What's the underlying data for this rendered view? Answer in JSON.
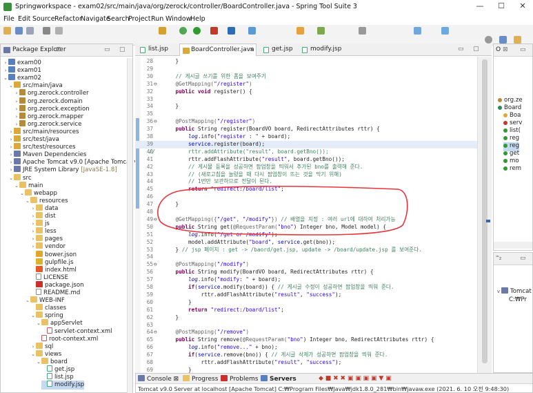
{
  "window": {
    "title": "Springworkspace - exam02/src/main/java/org/zerock/controller/BoardController.java - Spring Tool Suite 3",
    "minimize": "—",
    "maximize": "☐",
    "close": "✕"
  },
  "menu": [
    "File",
    "Edit",
    "Source",
    "Refactor",
    "Navigate",
    "Search",
    "Project",
    "Run",
    "Window",
    "Help"
  ],
  "package_explorer": {
    "tab": "Package Explorer",
    "items": [
      {
        "depth": 0,
        "tw": ">",
        "icon": "proj",
        "label": "exam00",
        "extra": ""
      },
      {
        "depth": 0,
        "tw": ">",
        "icon": "proj",
        "label": "exam01",
        "extra": ""
      },
      {
        "depth": 0,
        "tw": "v",
        "icon": "proj",
        "label": "exam02",
        "extra": ""
      },
      {
        "depth": 1,
        "tw": "v",
        "icon": "src",
        "label": "src/main/java",
        "extra": ""
      },
      {
        "depth": 2,
        "tw": ">",
        "icon": "pkg",
        "label": "org.zerock.controller",
        "extra": ""
      },
      {
        "depth": 2,
        "tw": ">",
        "icon": "pkg",
        "label": "org.zerock.domain",
        "extra": ""
      },
      {
        "depth": 2,
        "tw": ">",
        "icon": "pkg",
        "label": "org.zerock.exception",
        "extra": ""
      },
      {
        "depth": 2,
        "tw": ">",
        "icon": "pkg",
        "label": "org.zerock.mapper",
        "extra": ""
      },
      {
        "depth": 2,
        "tw": ">",
        "icon": "pkg",
        "label": "org.zerock.service",
        "extra": ""
      },
      {
        "depth": 1,
        "tw": ">",
        "icon": "src",
        "label": "src/main/resources",
        "extra": ""
      },
      {
        "depth": 1,
        "tw": ">",
        "icon": "src",
        "label": "src/test/java",
        "extra": ""
      },
      {
        "depth": 1,
        "tw": ">",
        "icon": "src",
        "label": "src/test/resources",
        "extra": ""
      },
      {
        "depth": 1,
        "tw": ">",
        "icon": "lib",
        "label": "Maven Dependencies",
        "extra": ""
      },
      {
        "depth": 1,
        "tw": ">",
        "icon": "lib",
        "label": "Apache Tomcat v9.0 [Apache Tomcat v9.",
        "extra": ""
      },
      {
        "depth": 1,
        "tw": ">",
        "icon": "lib",
        "label": "JRE System Library ",
        "extra": "[JavaSE-1.8]"
      },
      {
        "depth": 1,
        "tw": "v",
        "icon": "folder",
        "label": "src",
        "extra": ""
      },
      {
        "depth": 2,
        "tw": "v",
        "icon": "folder",
        "label": "main",
        "extra": ""
      },
      {
        "depth": 3,
        "tw": "v",
        "icon": "folder",
        "label": "webapp",
        "extra": ""
      },
      {
        "depth": 4,
        "tw": "v",
        "icon": "folder",
        "label": "resources",
        "extra": ""
      },
      {
        "depth": 5,
        "tw": ">",
        "icon": "folder",
        "label": "data",
        "extra": ""
      },
      {
        "depth": 5,
        "tw": ">",
        "icon": "folder",
        "label": "dist",
        "extra": ""
      },
      {
        "depth": 5,
        "tw": ">",
        "icon": "folder",
        "label": "js",
        "extra": ""
      },
      {
        "depth": 5,
        "tw": ">",
        "icon": "folder",
        "label": "less",
        "extra": ""
      },
      {
        "depth": 5,
        "tw": ">",
        "icon": "folder",
        "label": "pages",
        "extra": ""
      },
      {
        "depth": 5,
        "tw": ">",
        "icon": "folder",
        "label": "vendor",
        "extra": ""
      },
      {
        "depth": 5,
        "tw": "",
        "icon": "bower",
        "label": "bower.json",
        "extra": ""
      },
      {
        "depth": 5,
        "tw": "",
        "icon": "js",
        "label": "gulpfile.js",
        "extra": ""
      },
      {
        "depth": 5,
        "tw": "",
        "icon": "html",
        "label": "index.html",
        "extra": ""
      },
      {
        "depth": 5,
        "tw": "",
        "icon": "file",
        "label": "LICENSE",
        "extra": ""
      },
      {
        "depth": 5,
        "tw": "",
        "icon": "json",
        "label": "package.json",
        "extra": ""
      },
      {
        "depth": 5,
        "tw": "",
        "icon": "file",
        "label": "README.md",
        "extra": ""
      },
      {
        "depth": 4,
        "tw": "v",
        "icon": "folder",
        "label": "WEB-INF",
        "extra": ""
      },
      {
        "depth": 5,
        "tw": "",
        "icon": "folder",
        "label": "classes",
        "extra": ""
      },
      {
        "depth": 5,
        "tw": "v",
        "icon": "folder",
        "label": "spring",
        "extra": ""
      },
      {
        "depth": 6,
        "tw": "v",
        "icon": "folder",
        "label": "appServlet",
        "extra": ""
      },
      {
        "depth": 7,
        "tw": "",
        "icon": "xml",
        "label": "servlet-context.xml",
        "extra": ""
      },
      {
        "depth": 6,
        "tw": "",
        "icon": "xml",
        "label": "root-context.xml",
        "extra": ""
      },
      {
        "depth": 5,
        "tw": ">",
        "icon": "folder",
        "label": "sql",
        "extra": ""
      },
      {
        "depth": 5,
        "tw": "v",
        "icon": "folder",
        "label": "views",
        "extra": ""
      },
      {
        "depth": 6,
        "tw": "v",
        "icon": "folder",
        "label": "board",
        "extra": ""
      },
      {
        "depth": 7,
        "tw": "",
        "icon": "jsp",
        "label": "get.jsp",
        "extra": ""
      },
      {
        "depth": 7,
        "tw": "",
        "icon": "jsp",
        "label": "list.jsp",
        "extra": ""
      },
      {
        "depth": 7,
        "tw": "",
        "icon": "jsp",
        "label": "modify.jsp",
        "extra": ""
      }
    ]
  },
  "editor_tabs": [
    {
      "label": "list.jsp",
      "active": false
    },
    {
      "label": "BoardController.java",
      "active": true
    },
    {
      "label": "get.jsp",
      "active": false
    },
    {
      "label": "modify.jsp",
      "active": false
    }
  ],
  "code": [
    {
      "n": "28",
      "m": "",
      "t": [
        [
          "    }",
          ""
        ]
      ]
    },
    {
      "n": "29",
      "m": "",
      "t": [
        [
          "",
          ""
        ]
      ]
    },
    {
      "n": "30",
      "m": "",
      "t": [
        [
          "    // 게시글 쓰기를 위한 폼을 보여주기",
          "cm"
        ]
      ]
    },
    {
      "n": "31",
      "m": "⊖",
      "t": [
        [
          "    @GetMapping(",
          "an"
        ],
        [
          "\"/register\"",
          "st"
        ],
        [
          ")",
          "an"
        ]
      ]
    },
    {
      "n": "32",
      "m": "",
      "t": [
        [
          "    ",
          ""
        ],
        [
          "public void",
          "kw"
        ],
        [
          " register() {",
          ""
        ]
      ]
    },
    {
      "n": "33",
      "m": "",
      "t": [
        [
          "",
          ""
        ]
      ]
    },
    {
      "n": "34",
      "m": "",
      "t": [
        [
          "    }",
          ""
        ]
      ]
    },
    {
      "n": "35",
      "m": "",
      "t": [
        [
          "",
          ""
        ]
      ]
    },
    {
      "n": "36",
      "m": "⊖",
      "t": [
        [
          "    @PostMapping(",
          "an"
        ],
        [
          "\"/register\"",
          "st"
        ],
        [
          ")",
          "an"
        ]
      ]
    },
    {
      "n": "37",
      "m": "",
      "t": [
        [
          "    ",
          ""
        ],
        [
          "public",
          "kw"
        ],
        [
          " String register(BoardVO board, RedirectAttributes rttr) {",
          ""
        ]
      ]
    },
    {
      "n": "38",
      "m": "",
      "t": [
        [
          "        ",
          ""
        ],
        [
          "log",
          "fld it"
        ],
        [
          ".info(",
          ""
        ],
        [
          "\"register : \"",
          "st"
        ],
        [
          " + board);",
          ""
        ]
      ]
    },
    {
      "n": "39",
      "m": "",
      "t": [
        [
          "        ",
          ""
        ],
        [
          "service",
          "fld"
        ],
        [
          ".register(board);",
          ""
        ]
      ]
    },
    {
      "n": "40",
      "m": "//",
      "t": [
        [
          "        rttr.addAttribute(\"result\", board.getBno());",
          "cm"
        ]
      ]
    },
    {
      "n": "41",
      "m": "",
      "t": [
        [
          "        rttr.addFlashAttribute(",
          ""
        ],
        [
          "\"result\"",
          "st"
        ],
        [
          ", board.getBno());",
          ""
        ]
      ]
    },
    {
      "n": "42",
      "m": "",
      "t": [
        [
          "        // 게시물 등록을 성공하면 팝업창을 띄워서 추가된 bno를 출력해 준다.",
          "cm"
        ]
      ]
    },
    {
      "n": "43",
      "m": "",
      "t": [
        [
          "        // (새로고침을 눌렀을 때 다시 팝업창이 뜨는 것을 막기 위해)",
          "cm"
        ]
      ]
    },
    {
      "n": "44",
      "m": "",
      "t": [
        [
          "        // 1번만 보관하므로 전달이 된다.",
          "cm"
        ]
      ]
    },
    {
      "n": "45",
      "m": "",
      "t": [
        [
          "        ",
          ""
        ],
        [
          "return",
          "kw"
        ],
        [
          " ",
          ""
        ],
        [
          "\"redirect:/board/list\"",
          "st"
        ],
        [
          ";",
          ""
        ]
      ]
    },
    {
      "n": "46",
      "m": "",
      "t": [
        [
          "",
          ""
        ]
      ]
    },
    {
      "n": "47",
      "m": "",
      "t": [
        [
          "    }",
          ""
        ]
      ]
    },
    {
      "n": "48",
      "m": "",
      "t": [
        [
          "",
          ""
        ]
      ]
    },
    {
      "n": "49",
      "m": "⊖",
      "t": [
        [
          "    @GetMapping({",
          "an"
        ],
        [
          "\"/get\"",
          "st"
        ],
        [
          ", ",
          "an"
        ],
        [
          "\"/modify\"",
          "st"
        ],
        [
          "}) ",
          "an"
        ],
        [
          "// 배열을 지정 : 여러 url에 대하여 처리가능",
          "cm"
        ]
      ]
    },
    {
      "n": "50",
      "m": "",
      "t": [
        [
          "    ",
          ""
        ],
        [
          "public",
          "kw"
        ],
        [
          " String get(",
          ""
        ],
        [
          "@RequestParam(",
          "an"
        ],
        [
          "\"bno\"",
          "st"
        ],
        [
          ") Integer bno, Model model) {",
          ""
        ]
      ]
    },
    {
      "n": "51",
      "m": "",
      "t": [
        [
          "        ",
          ""
        ],
        [
          "log",
          "fld it"
        ],
        [
          ".info(",
          ""
        ],
        [
          "\"/get or /modify\"",
          "st"
        ],
        [
          ");",
          ""
        ]
      ]
    },
    {
      "n": "52",
      "m": "",
      "t": [
        [
          "        model.addAttribute(",
          ""
        ],
        [
          "\"board\"",
          "st"
        ],
        [
          ", ",
          ""
        ],
        [
          "service",
          "fld"
        ],
        [
          ".get(bno));",
          ""
        ]
      ]
    },
    {
      "n": "53",
      "m": "",
      "t": [
        [
          "    } ",
          ""
        ],
        [
          "// jsp 페이지 : get -> /baord/get.jsp, update -> /board/update.jsp 를 보여준다.",
          "cm"
        ]
      ]
    },
    {
      "n": "54",
      "m": "",
      "t": [
        [
          "",
          ""
        ]
      ]
    },
    {
      "n": "55",
      "m": "⊖",
      "t": [
        [
          "    @PostMapping(",
          "an"
        ],
        [
          "\"/modify\"",
          "st"
        ],
        [
          ")",
          "an"
        ]
      ]
    },
    {
      "n": "56",
      "m": "",
      "t": [
        [
          "    ",
          ""
        ],
        [
          "public",
          "kw"
        ],
        [
          " String modify(BoardVO board, RedirectAttributes rttr) {",
          ""
        ]
      ]
    },
    {
      "n": "57",
      "m": "",
      "t": [
        [
          "        ",
          ""
        ],
        [
          "log",
          "fld it"
        ],
        [
          ".info(",
          ""
        ],
        [
          "\"modify: \"",
          "st"
        ],
        [
          " + board);",
          ""
        ]
      ]
    },
    {
      "n": "58",
      "m": "",
      "t": [
        [
          "        ",
          ""
        ],
        [
          "if",
          "kw"
        ],
        [
          "(",
          ""
        ],
        [
          "service",
          "fld"
        ],
        [
          ".modify(board)) { ",
          ""
        ],
        [
          "// 게시글 수정이 성공하면 팝업창을 띄워 준다.",
          "cm"
        ]
      ]
    },
    {
      "n": "59",
      "m": "",
      "t": [
        [
          "            rttr.addFlashAttribute(",
          ""
        ],
        [
          "\"result\"",
          "st"
        ],
        [
          ", ",
          ""
        ],
        [
          "\"success\"",
          "st"
        ],
        [
          ");",
          ""
        ]
      ]
    },
    {
      "n": "60",
      "m": "",
      "t": [
        [
          "        }",
          ""
        ]
      ]
    },
    {
      "n": "61",
      "m": "",
      "t": [
        [
          "        ",
          ""
        ],
        [
          "return",
          "kw"
        ],
        [
          " ",
          ""
        ],
        [
          "\"redirect:/board/list\"",
          "st"
        ],
        [
          ";",
          ""
        ]
      ]
    },
    {
      "n": "62",
      "m": "",
      "t": [
        [
          "    }",
          ""
        ]
      ]
    },
    {
      "n": "63",
      "m": "",
      "t": [
        [
          "",
          ""
        ]
      ]
    },
    {
      "n": "64",
      "m": "⊖",
      "t": [
        [
          "    @PostMapping(",
          "an"
        ],
        [
          "\"/remove\"",
          "st"
        ],
        [
          ")",
          "an"
        ]
      ]
    },
    {
      "n": "65",
      "m": "",
      "t": [
        [
          "    ",
          ""
        ],
        [
          "public",
          "kw"
        ],
        [
          " String remove(",
          ""
        ],
        [
          "@RequestParam(",
          "an"
        ],
        [
          "\"bno\"",
          "st"
        ],
        [
          ") Integer bno, RedirectAttributes rttr) {",
          ""
        ]
      ]
    },
    {
      "n": "66",
      "m": "",
      "t": [
        [
          "        ",
          ""
        ],
        [
          "log",
          "fld it"
        ],
        [
          ".info(",
          ""
        ],
        [
          "\"remove...\"",
          "st"
        ],
        [
          " + bno);",
          ""
        ]
      ]
    },
    {
      "n": "67",
      "m": "",
      "t": [
        [
          "        ",
          ""
        ],
        [
          "if",
          "kw"
        ],
        [
          "(",
          ""
        ],
        [
          "service",
          "fld"
        ],
        [
          ".remove(bno)) { ",
          ""
        ],
        [
          "// 게시글 삭제가 성공하면 팝업창을 띄워 준다.",
          "cm"
        ]
      ]
    },
    {
      "n": "68",
      "m": "",
      "t": [
        [
          "            rttr.addFlashAttribute(",
          ""
        ],
        [
          "\"result\"",
          "st"
        ],
        [
          ", ",
          ""
        ],
        [
          "\"success\"",
          "st"
        ],
        [
          ");",
          ""
        ]
      ]
    },
    {
      "n": "69",
      "m": "",
      "t": [
        [
          "        }",
          ""
        ]
      ]
    },
    {
      "n": "70",
      "m": "",
      "t": [
        [
          "        ",
          ""
        ],
        [
          "return",
          "kw"
        ],
        [
          " ",
          ""
        ],
        [
          "\"redirect:/board/list\"",
          "st"
        ],
        [
          ";",
          ""
        ]
      ]
    },
    {
      "n": "71",
      "m": "",
      "t": [
        [
          "    }",
          ""
        ]
      ]
    },
    {
      "n": "72",
      "m": "",
      "t": [
        [
          "",
          ""
        ]
      ]
    },
    {
      "n": "73",
      "m": "",
      "t": [
        [
          "}",
          ""
        ]
      ]
    },
    {
      "n": "74",
      "m": "",
      "t": [
        [
          "",
          ""
        ]
      ]
    }
  ],
  "outline": {
    "tab": "O",
    "items": [
      "org.ze",
      "Board",
      "Boa",
      "serv",
      "list(",
      "reg",
      "reg",
      "get",
      "mo",
      "rem"
    ]
  },
  "servers_panel": {
    "items": [
      "Tomcat v",
      "C:₩Pr"
    ]
  },
  "console": {
    "tabs": [
      "Console",
      "Progress",
      "Problems",
      "Servers"
    ],
    "status": "Tomcat v9.0 Server at localhost [Apache Tomcat] C:₩Program Files₩Java₩jdk1.8.0_281₩bin₩javaw.exe  (2021. 6. 10 오전 9:48:30)"
  },
  "colors": {
    "annotation_circle": "#e8343a",
    "selection": "#c5d9f1",
    "keyword": "#7f0055",
    "string": "#2a00ff",
    "comment": "#3f7f5f"
  }
}
